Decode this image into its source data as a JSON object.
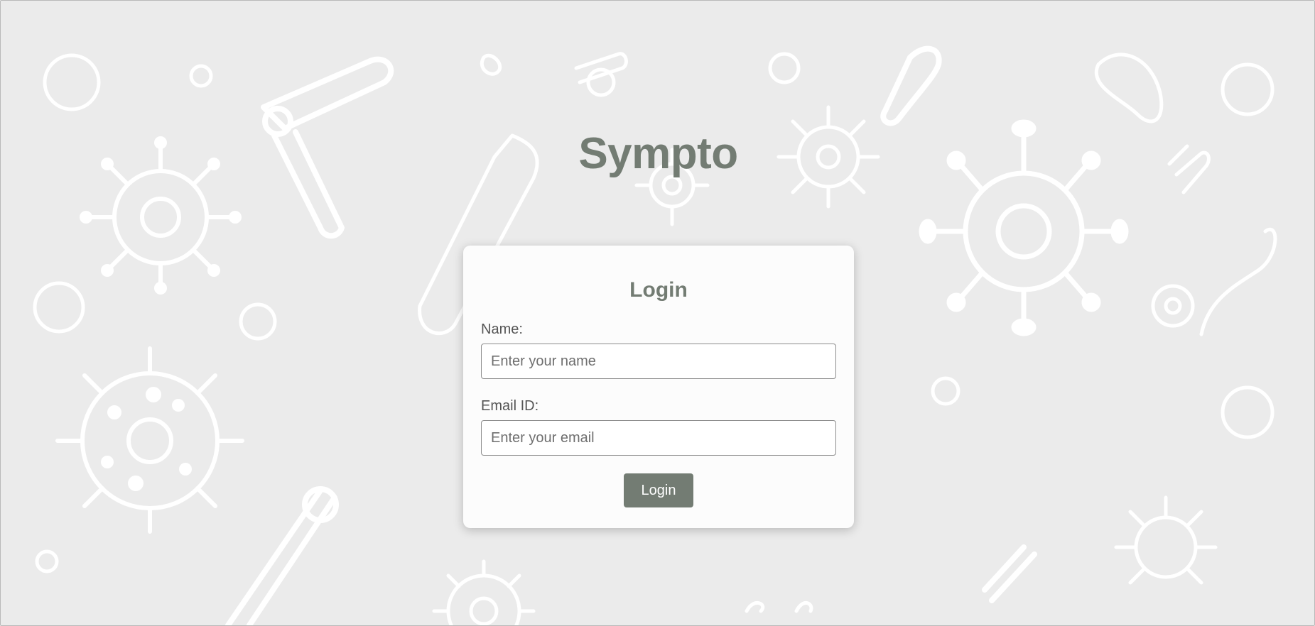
{
  "app": {
    "title": "Sympto"
  },
  "login_form": {
    "heading": "Login",
    "name_label": "Name:",
    "name_placeholder": "Enter your name",
    "name_value": "",
    "email_label": "Email ID:",
    "email_placeholder": "Enter your email",
    "email_value": "",
    "submit_label": "Login"
  },
  "colors": {
    "background": "#ebebeb",
    "accent": "#737c73",
    "card": "#fcfcfc",
    "doodle": "#ffffff"
  },
  "icons": {
    "background_pattern": [
      "virus-icon",
      "bacteria-icon",
      "microscope-tool-icon",
      "cell-icon",
      "pipette-icon"
    ]
  }
}
